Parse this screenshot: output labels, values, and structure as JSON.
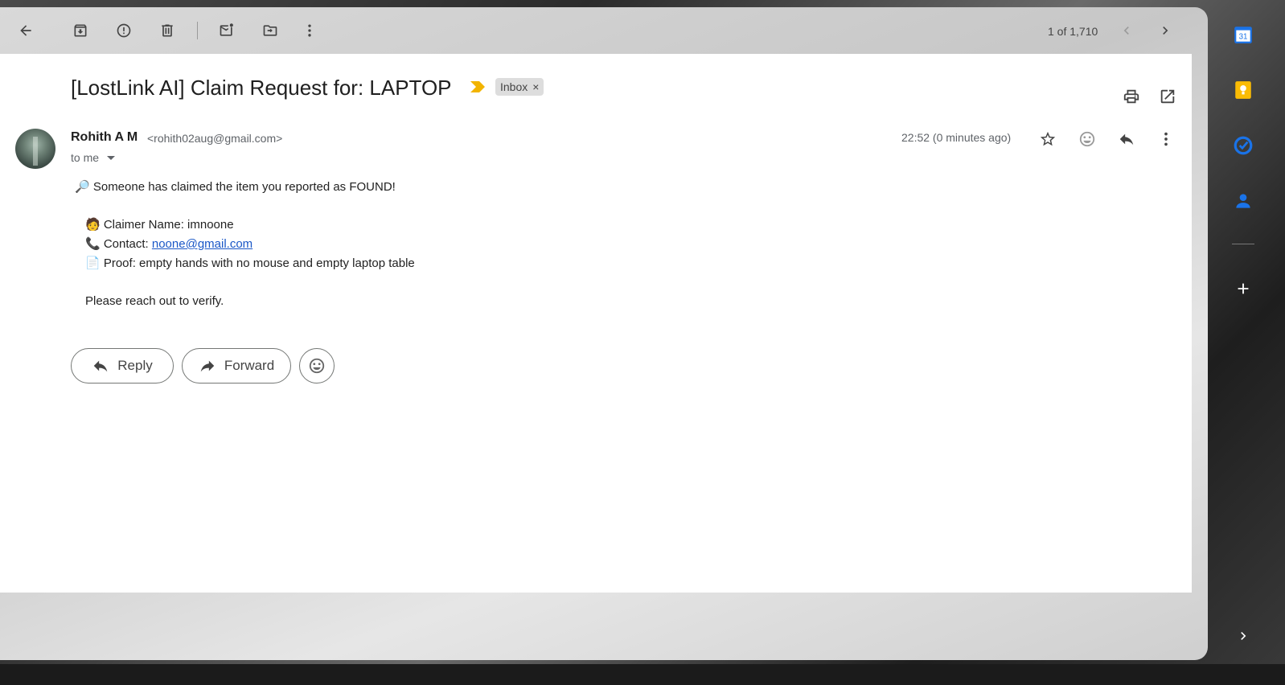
{
  "toolbar": {
    "counter": "1 of 1,710"
  },
  "email": {
    "subject": "[LostLink AI] Claim Request for: LAPTOP",
    "label": "Inbox",
    "label_remove": "×",
    "sender_name": "Rohith A M",
    "sender_email": "<rohith02aug@gmail.com>",
    "recipient": "to me",
    "time": "22:52 (0 minutes ago)",
    "body": {
      "line1": "🔎 Someone has claimed the item you reported as FOUND!",
      "claimer": "🧑 Claimer Name: imnoone",
      "contact_prefix": "📞 Contact: ",
      "contact_email": "noone@gmail.com",
      "proof": "📄 Proof: empty hands with no mouse and empty laptop table",
      "closing": "Please reach out to verify."
    }
  },
  "actions": {
    "reply": "Reply",
    "forward": "Forward"
  },
  "side_panel": {
    "calendar_day": "31",
    "colors": {
      "calendar": "#1a73e8",
      "keep": "#fbbc04",
      "tasks": "#1a73e8",
      "contacts": "#1a73e8"
    }
  },
  "colors": {
    "importance_marker": "#f2b400",
    "link": "#1a57c7"
  }
}
